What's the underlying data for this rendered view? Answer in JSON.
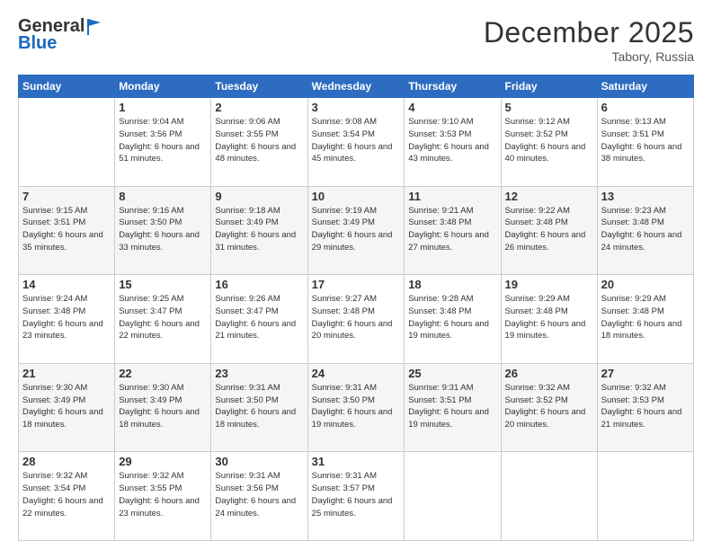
{
  "header": {
    "logo_line1": "General",
    "logo_line2": "Blue",
    "month": "December 2025",
    "location": "Tabory, Russia"
  },
  "weekdays": [
    "Sunday",
    "Monday",
    "Tuesday",
    "Wednesday",
    "Thursday",
    "Friday",
    "Saturday"
  ],
  "weeks": [
    [
      {
        "day": "",
        "sunrise": "",
        "sunset": "",
        "daylight": ""
      },
      {
        "day": "1",
        "sunrise": "Sunrise: 9:04 AM",
        "sunset": "Sunset: 3:56 PM",
        "daylight": "Daylight: 6 hours and 51 minutes."
      },
      {
        "day": "2",
        "sunrise": "Sunrise: 9:06 AM",
        "sunset": "Sunset: 3:55 PM",
        "daylight": "Daylight: 6 hours and 48 minutes."
      },
      {
        "day": "3",
        "sunrise": "Sunrise: 9:08 AM",
        "sunset": "Sunset: 3:54 PM",
        "daylight": "Daylight: 6 hours and 45 minutes."
      },
      {
        "day": "4",
        "sunrise": "Sunrise: 9:10 AM",
        "sunset": "Sunset: 3:53 PM",
        "daylight": "Daylight: 6 hours and 43 minutes."
      },
      {
        "day": "5",
        "sunrise": "Sunrise: 9:12 AM",
        "sunset": "Sunset: 3:52 PM",
        "daylight": "Daylight: 6 hours and 40 minutes."
      },
      {
        "day": "6",
        "sunrise": "Sunrise: 9:13 AM",
        "sunset": "Sunset: 3:51 PM",
        "daylight": "Daylight: 6 hours and 38 minutes."
      }
    ],
    [
      {
        "day": "7",
        "sunrise": "Sunrise: 9:15 AM",
        "sunset": "Sunset: 3:51 PM",
        "daylight": "Daylight: 6 hours and 35 minutes."
      },
      {
        "day": "8",
        "sunrise": "Sunrise: 9:16 AM",
        "sunset": "Sunset: 3:50 PM",
        "daylight": "Daylight: 6 hours and 33 minutes."
      },
      {
        "day": "9",
        "sunrise": "Sunrise: 9:18 AM",
        "sunset": "Sunset: 3:49 PM",
        "daylight": "Daylight: 6 hours and 31 minutes."
      },
      {
        "day": "10",
        "sunrise": "Sunrise: 9:19 AM",
        "sunset": "Sunset: 3:49 PM",
        "daylight": "Daylight: 6 hours and 29 minutes."
      },
      {
        "day": "11",
        "sunrise": "Sunrise: 9:21 AM",
        "sunset": "Sunset: 3:48 PM",
        "daylight": "Daylight: 6 hours and 27 minutes."
      },
      {
        "day": "12",
        "sunrise": "Sunrise: 9:22 AM",
        "sunset": "Sunset: 3:48 PM",
        "daylight": "Daylight: 6 hours and 26 minutes."
      },
      {
        "day": "13",
        "sunrise": "Sunrise: 9:23 AM",
        "sunset": "Sunset: 3:48 PM",
        "daylight": "Daylight: 6 hours and 24 minutes."
      }
    ],
    [
      {
        "day": "14",
        "sunrise": "Sunrise: 9:24 AM",
        "sunset": "Sunset: 3:48 PM",
        "daylight": "Daylight: 6 hours and 23 minutes."
      },
      {
        "day": "15",
        "sunrise": "Sunrise: 9:25 AM",
        "sunset": "Sunset: 3:47 PM",
        "daylight": "Daylight: 6 hours and 22 minutes."
      },
      {
        "day": "16",
        "sunrise": "Sunrise: 9:26 AM",
        "sunset": "Sunset: 3:47 PM",
        "daylight": "Daylight: 6 hours and 21 minutes."
      },
      {
        "day": "17",
        "sunrise": "Sunrise: 9:27 AM",
        "sunset": "Sunset: 3:48 PM",
        "daylight": "Daylight: 6 hours and 20 minutes."
      },
      {
        "day": "18",
        "sunrise": "Sunrise: 9:28 AM",
        "sunset": "Sunset: 3:48 PM",
        "daylight": "Daylight: 6 hours and 19 minutes."
      },
      {
        "day": "19",
        "sunrise": "Sunrise: 9:29 AM",
        "sunset": "Sunset: 3:48 PM",
        "daylight": "Daylight: 6 hours and 19 minutes."
      },
      {
        "day": "20",
        "sunrise": "Sunrise: 9:29 AM",
        "sunset": "Sunset: 3:48 PM",
        "daylight": "Daylight: 6 hours and 18 minutes."
      }
    ],
    [
      {
        "day": "21",
        "sunrise": "Sunrise: 9:30 AM",
        "sunset": "Sunset: 3:49 PM",
        "daylight": "Daylight: 6 hours and 18 minutes."
      },
      {
        "day": "22",
        "sunrise": "Sunrise: 9:30 AM",
        "sunset": "Sunset: 3:49 PM",
        "daylight": "Daylight: 6 hours and 18 minutes."
      },
      {
        "day": "23",
        "sunrise": "Sunrise: 9:31 AM",
        "sunset": "Sunset: 3:50 PM",
        "daylight": "Daylight: 6 hours and 18 minutes."
      },
      {
        "day": "24",
        "sunrise": "Sunrise: 9:31 AM",
        "sunset": "Sunset: 3:50 PM",
        "daylight": "Daylight: 6 hours and 19 minutes."
      },
      {
        "day": "25",
        "sunrise": "Sunrise: 9:31 AM",
        "sunset": "Sunset: 3:51 PM",
        "daylight": "Daylight: 6 hours and 19 minutes."
      },
      {
        "day": "26",
        "sunrise": "Sunrise: 9:32 AM",
        "sunset": "Sunset: 3:52 PM",
        "daylight": "Daylight: 6 hours and 20 minutes."
      },
      {
        "day": "27",
        "sunrise": "Sunrise: 9:32 AM",
        "sunset": "Sunset: 3:53 PM",
        "daylight": "Daylight: 6 hours and 21 minutes."
      }
    ],
    [
      {
        "day": "28",
        "sunrise": "Sunrise: 9:32 AM",
        "sunset": "Sunset: 3:54 PM",
        "daylight": "Daylight: 6 hours and 22 minutes."
      },
      {
        "day": "29",
        "sunrise": "Sunrise: 9:32 AM",
        "sunset": "Sunset: 3:55 PM",
        "daylight": "Daylight: 6 hours and 23 minutes."
      },
      {
        "day": "30",
        "sunrise": "Sunrise: 9:31 AM",
        "sunset": "Sunset: 3:56 PM",
        "daylight": "Daylight: 6 hours and 24 minutes."
      },
      {
        "day": "31",
        "sunrise": "Sunrise: 9:31 AM",
        "sunset": "Sunset: 3:57 PM",
        "daylight": "Daylight: 6 hours and 25 minutes."
      },
      {
        "day": "",
        "sunrise": "",
        "sunset": "",
        "daylight": ""
      },
      {
        "day": "",
        "sunrise": "",
        "sunset": "",
        "daylight": ""
      },
      {
        "day": "",
        "sunrise": "",
        "sunset": "",
        "daylight": ""
      }
    ]
  ]
}
